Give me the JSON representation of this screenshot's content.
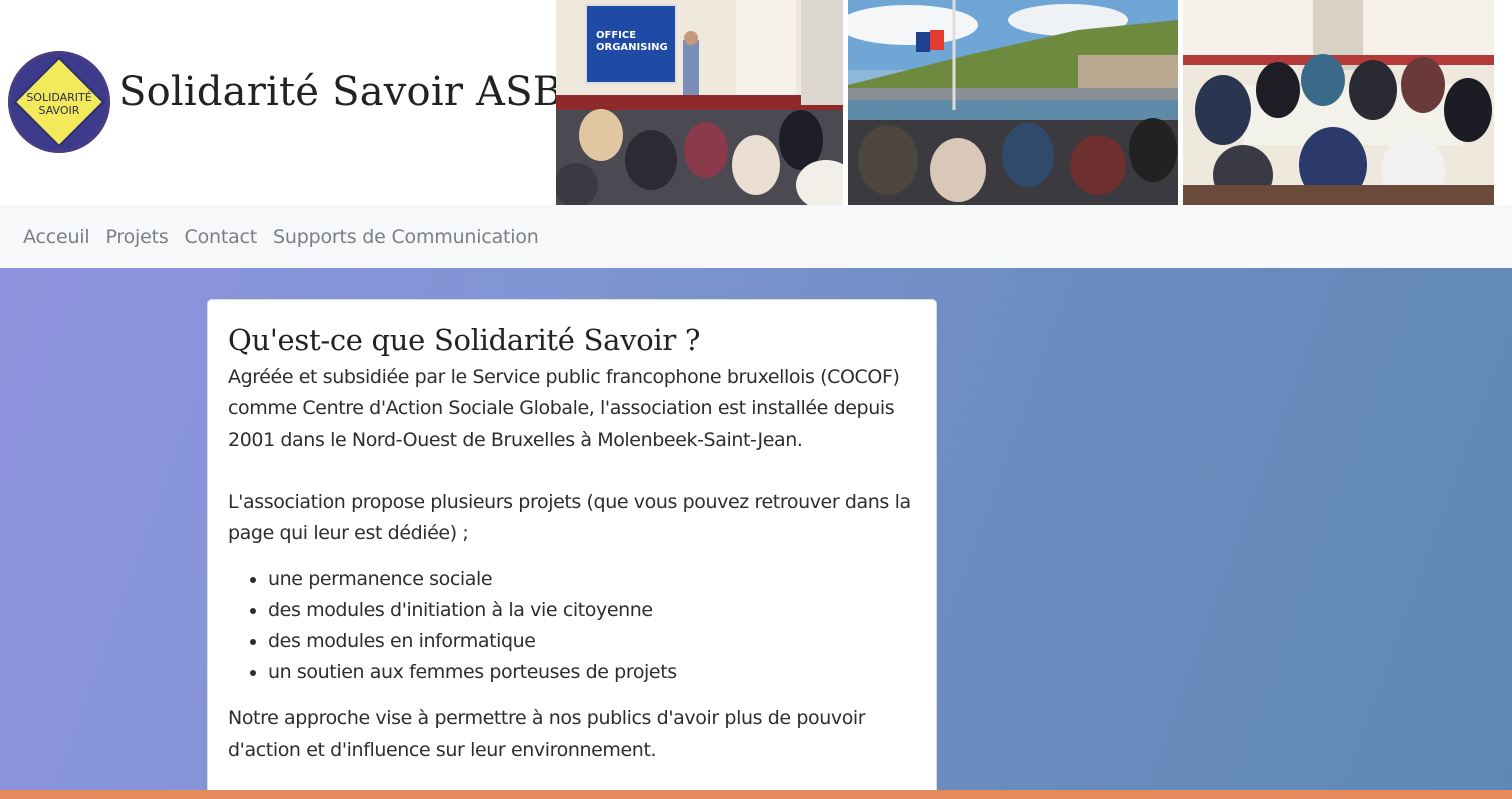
{
  "header": {
    "logo_line1": "SOLIDARITÉ",
    "logo_line2": "SAVOIR",
    "site_title": "Solidarité Savoir ASBL",
    "photo_1_screen_line1": "OFFICE",
    "photo_1_screen_line2": "ORGANISING"
  },
  "nav": {
    "items": [
      {
        "label": "Acceuil"
      },
      {
        "label": "Projets"
      },
      {
        "label": "Contact"
      },
      {
        "label": "Supports de Communication"
      }
    ]
  },
  "main": {
    "title": "Qu'est-ce que Solidarité Savoir ?",
    "intro": "Agrééе et subsidiée par le Service public francophone bruxellois (COCOF) comme Centre d'Action Sociale Globale, l'association est installée depuis 2001 dans le Nord-Ouest de Bruxelles à Molenbeek-Saint-Jean.",
    "projects_intro": "L'association propose plusieurs projets (que vous pouvez retrouver dans la page qui leur est dédiée) ;",
    "projects": [
      "une permanence sociale",
      "des modules d'initiation à la vie citoyenne",
      "des modules en informatique",
      "un soutien aux femmes porteuses de projets"
    ],
    "approach": "Notre approche vise à permettre à nos publics d'avoir plus de pouvoir d'action et d'influence sur leur environnement."
  },
  "colors": {
    "logo_ring": "#4a3d85",
    "logo_fill": "#f3ea5b",
    "nav_bg": "#f7f8f9",
    "nav_text": "#7a7f85",
    "gradient_start": "#8f93df",
    "gradient_end": "#5f89b4",
    "bottom_bar": "#e48a5c"
  }
}
